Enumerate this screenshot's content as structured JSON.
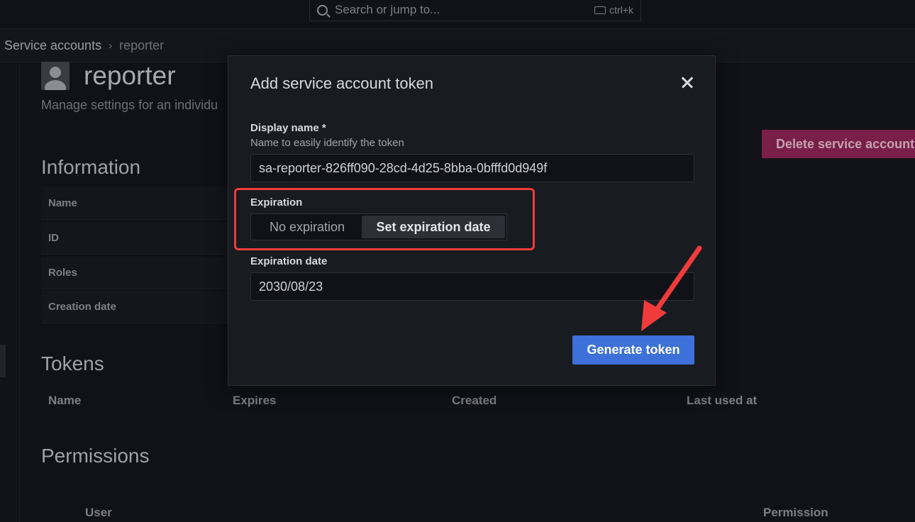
{
  "topbar": {
    "search_placeholder": "Search or jump to...",
    "shortcut": "ctrl+k"
  },
  "breadcrumb": {
    "parent": "Service accounts",
    "separator": "›",
    "current": "reporter"
  },
  "page": {
    "title": "reporter",
    "subtitle": "Manage settings for an individu",
    "delete_button": "Delete service account"
  },
  "information": {
    "heading": "Information",
    "rows": [
      "Name",
      "ID",
      "Roles",
      "Creation date"
    ]
  },
  "tokens": {
    "heading": "Tokens",
    "columns": [
      "Name",
      "Expires",
      "Created",
      "Last used at"
    ]
  },
  "permissions": {
    "heading": "Permissions",
    "columns": [
      "User",
      "Permission"
    ]
  },
  "modal": {
    "title": "Add service account token",
    "display_name_label": "Display name *",
    "display_name_description": "Name to easily identify the token",
    "display_name_value": "sa-reporter-826ff090-28cd-4d25-8bba-0bfffd0d949f",
    "expiration_label": "Expiration",
    "expiration_options": [
      "No expiration",
      "Set expiration date"
    ],
    "expiration_selected": "Set expiration date",
    "expiration_date_label": "Expiration date",
    "expiration_date_value": "2030/08/23",
    "generate_button": "Generate token"
  },
  "annotations": {
    "highlight_color": "#ef3b3b",
    "arrow_color": "#ef3b3b"
  },
  "colors": {
    "primary_button": "#3d71d9",
    "destructive_button": "#7a1e4a"
  }
}
